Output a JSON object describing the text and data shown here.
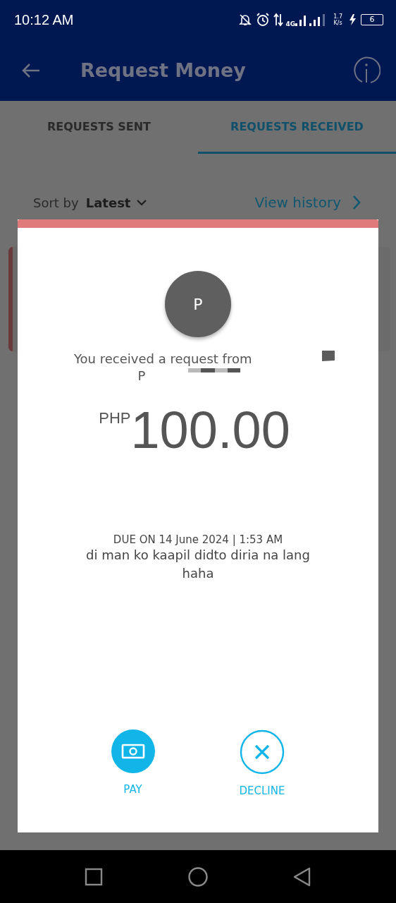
{
  "status_bar": {
    "time": "10:12 AM",
    "network": "4G",
    "speed_value": "1.7",
    "speed_unit": "K/s",
    "battery": "6"
  },
  "app_bar": {
    "title": "Request Money"
  },
  "tabs": [
    {
      "label": "REQUESTS SENT",
      "selected": false
    },
    {
      "label": "REQUESTS RECEIVED",
      "selected": true
    }
  ],
  "sort": {
    "label": "Sort by",
    "value": "Latest"
  },
  "view_history": "View history",
  "dialog": {
    "avatar_initial": "P",
    "message": "You received a request from",
    "sender": "P",
    "currency": "PHP",
    "amount": "100.00",
    "due": "DUE ON 14 June 2024 | 1:53 AM",
    "note": "di man ko kaapil didto diria na lang haha",
    "actions": [
      {
        "kind": "pay",
        "label": "PAY"
      },
      {
        "kind": "decline",
        "label": "DECLINE"
      }
    ]
  }
}
